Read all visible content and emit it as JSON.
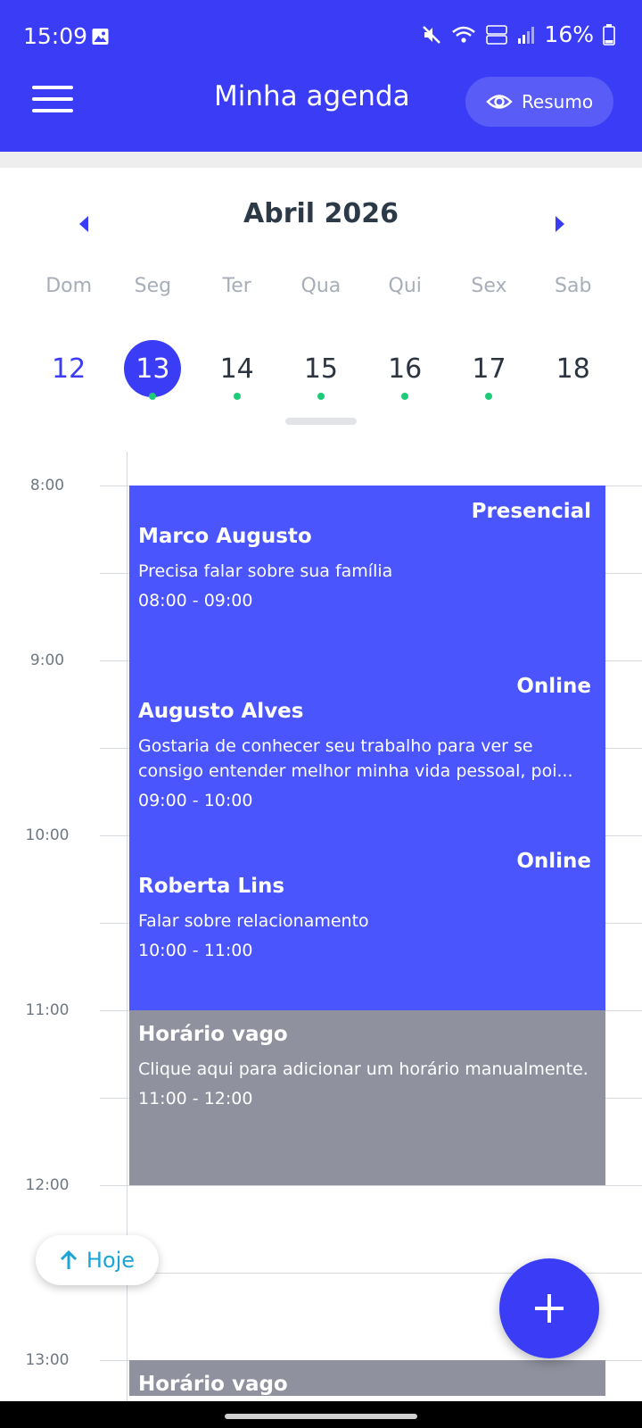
{
  "status_bar": {
    "time": "15:09",
    "battery": "16%",
    "icons": [
      "gallery-icon",
      "mute-icon",
      "wifi-icon",
      "volte-icon",
      "signal-icon",
      "battery-icon"
    ]
  },
  "header": {
    "title": "Minha agenda",
    "resumo_label": "Resumo",
    "background": "#3a3df5"
  },
  "calendar": {
    "month": "Abril 2026",
    "weekdays": [
      "Dom",
      "Seg",
      "Ter",
      "Qua",
      "Qui",
      "Sex",
      "Sab"
    ],
    "days": [
      {
        "number": "12",
        "selected": false,
        "has_events": false
      },
      {
        "number": "13",
        "selected": true,
        "has_events": true
      },
      {
        "number": "14",
        "selected": false,
        "has_events": true
      },
      {
        "number": "15",
        "selected": false,
        "has_events": true
      },
      {
        "number": "16",
        "selected": false,
        "has_events": true
      },
      {
        "number": "17",
        "selected": false,
        "has_events": true
      },
      {
        "number": "18",
        "selected": false,
        "has_events": false
      }
    ]
  },
  "timeline": {
    "hours": [
      "8:00",
      "9:00",
      "10:00",
      "11:00",
      "12:00",
      "13:00"
    ],
    "events": [
      {
        "type": "Presencial",
        "name": "Marco Augusto",
        "description": "Precisa falar sobre sua família",
        "time": "08:00 - 09:00",
        "status": "booked"
      },
      {
        "type": "Online",
        "name": "Augusto Alves",
        "description": "Gostaria de conhecer seu trabalho para ver se consigo entender melhor minha vida pessoal, poi...",
        "time": "09:00 - 10:00",
        "status": "booked"
      },
      {
        "type": "Online",
        "name": "Roberta Lins",
        "description": "Falar sobre relacionamento",
        "time": "10:00 - 11:00",
        "status": "booked"
      },
      {
        "type": "",
        "name": "Horário vago",
        "description": "Clique aqui para adicionar um horário manualmente.",
        "time": "11:00 - 12:00",
        "status": "free"
      }
    ],
    "partial_event_name": "Horário vago"
  },
  "hoje_label": "Hoje",
  "colors": {
    "primary": "#3a3df5",
    "booked": "#4b55fe",
    "free": "#8f919e",
    "event_dot": "#1ecb7a",
    "hoje_text": "#1aa5d8"
  }
}
